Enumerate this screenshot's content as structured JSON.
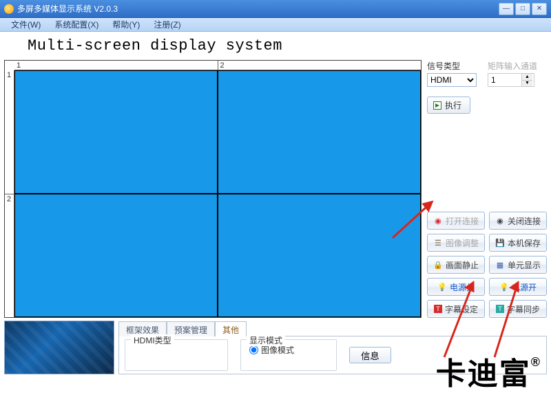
{
  "window": {
    "title": "多屏多媒体显示系统 V2.0.3"
  },
  "menu": {
    "file": "文件(W)",
    "config": "系统配置(X)",
    "help": "帮助(Y)",
    "register": "注册(Z)"
  },
  "heading": "Multi-screen display system",
  "ruler": {
    "col1": "1",
    "col2": "2",
    "row1": "1",
    "row2": "2"
  },
  "side": {
    "signal_type_label": "信号类型",
    "signal_type_value": "HDMI",
    "matrix_channel_label": "矩阵输入通道",
    "matrix_channel_value": "1",
    "execute": "执行",
    "open_conn": "打开连接",
    "close_conn": "关闭连接",
    "image_adjust": "图像调整",
    "local_save": "本机保存",
    "freeze": "画面静止",
    "unit_display": "单元显示",
    "power_off": "电源关",
    "power_on": "电源开",
    "subtitle_set": "字幕设定",
    "subtitle_sync": "字幕同步"
  },
  "tabs": {
    "frame_effect": "框架效果",
    "preset_mgmt": "预案管理",
    "other": "其他",
    "hdmi_type_legend": "HDMI类型",
    "display_mode_legend": "显示模式",
    "image_mode": "图像模式",
    "info": "信息"
  },
  "watermark": {
    "text": "卡迪富",
    "reg": "®"
  }
}
